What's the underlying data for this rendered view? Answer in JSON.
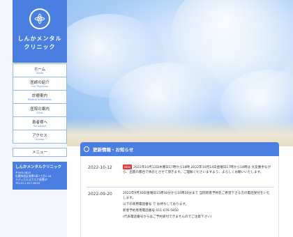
{
  "clinic": {
    "name_line1": "しんかメンタル",
    "name_line2": "クリニック"
  },
  "nav": [
    {
      "jp": "ホーム",
      "en": "Home"
    },
    {
      "jp": "医師の紹介",
      "en": "Our Physician"
    },
    {
      "jp": "診療案内",
      "en": "Medical Information"
    },
    {
      "jp": "医院の案内",
      "en": "Clinic"
    },
    {
      "jp": "患者様へ",
      "en": "For patient"
    },
    {
      "jp": "アクセス",
      "en": "Access"
    }
  ],
  "menu_label": "メニュー",
  "info": {
    "title": "しんかメンタルクリニック",
    "lines": [
      "〒063-0825",
      "札幌市西区発寒5条7丁目1-18",
      "メディカルスクエア発寒2F",
      "TEL:011-617-8019"
    ]
  },
  "news": {
    "header": "更新情報・お知らせ",
    "items": [
      {
        "date": "2022-10-12",
        "badge": "NEW",
        "lines": [
          "2022年10月13日木曜日17時から18時 2022年10月14日金曜日17時から18時は 大変勝手ながら、出張の都合で休診とさせて頂きます。ご理解くださいますよう、よろしくお願いいたします。"
        ]
      },
      {
        "date": "2022-09-20",
        "badge": "",
        "lines": [
          "2022年9月30日金曜日15時30分から16時30分まで 当院新患予約をご希望下さる方の電話受付をいたします。",
          "以下の専用電話番号 で お待ちしております。",
          "新患予約専用電話番号 011-676-5850",
          "(代表電話番号からはご予約受付できませんのでご注意下さい)"
        ]
      }
    ]
  },
  "colors": {
    "accent": "#4a7ee0",
    "badge": "#e23d3d"
  }
}
